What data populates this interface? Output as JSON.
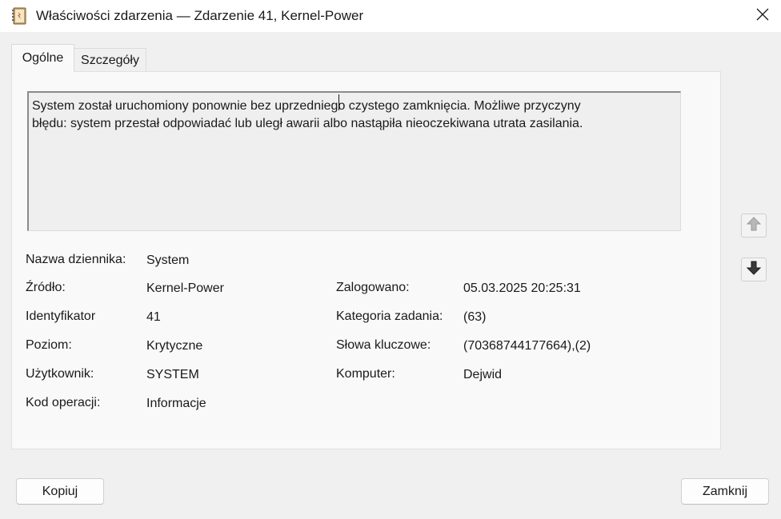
{
  "window": {
    "title": "Właściwości zdarzenia — Zdarzenie 41, Kernel-Power",
    "icon": "event-log-icon",
    "close_icon": "close-icon"
  },
  "tabs": [
    {
      "label": "Ogólne",
      "selected": true
    },
    {
      "label": "Szczegóły",
      "selected": false
    }
  ],
  "description": {
    "line1": "System został uruchomiony ponownie bez uprzedniego czystego zamknięcia. Możliwe przyczyny",
    "line2": "błędu: system przestał odpowiadać lub uległ awarii albo nastąpiła nieoczekiwana utrata zasilania."
  },
  "fields": {
    "log_name": {
      "label": "Nazwa dziennika:",
      "value": "System"
    },
    "source": {
      "label": "Źródło:",
      "value": "Kernel-Power"
    },
    "event_id": {
      "label": "Identyfikator",
      "value": "41"
    },
    "level": {
      "label": "Poziom:",
      "value": "Krytyczne"
    },
    "user": {
      "label": "Użytkownik:",
      "value": "SYSTEM"
    },
    "opcode": {
      "label": "Kod operacji:",
      "value": "Informacje"
    },
    "logged": {
      "label": "Zalogowano:",
      "value": "05.03.2025 20:25:31"
    },
    "task_category": {
      "label": "Kategoria zadania:",
      "value": "(63)"
    },
    "keywords": {
      "label": "Słowa kluczowe:",
      "value": "(70368744177664),(2)"
    },
    "computer": {
      "label": "Komputer:",
      "value": "Dejwid"
    }
  },
  "nav": {
    "up_icon": "arrow-up-icon",
    "down_icon": "arrow-down-icon"
  },
  "buttons": {
    "copy": "Kopiuj",
    "close": "Zamknij"
  }
}
